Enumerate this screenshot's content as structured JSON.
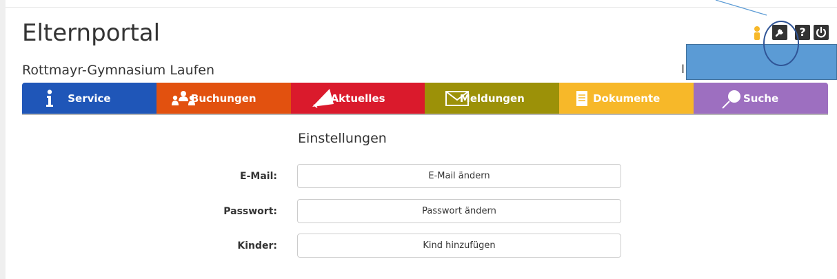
{
  "header": {
    "app_title": "Elternportal",
    "school_name": "Rottmayr-Gymnasium Laufen",
    "truncated_text": "I"
  },
  "toolbar": {
    "icons": [
      "user-icon",
      "wrench-icon",
      "help-icon",
      "power-icon"
    ],
    "help_glyph": "?"
  },
  "nav": {
    "items": [
      {
        "label": "Service",
        "icon": "info-icon",
        "color": "#1f56b8"
      },
      {
        "label": "Buchungen",
        "icon": "people-icon",
        "color": "#e2510f"
      },
      {
        "label": "Aktuelles",
        "icon": "megaphone-icon",
        "color": "#da1a2c"
      },
      {
        "label": "Meldungen",
        "icon": "envelope-icon",
        "color": "#9c9108"
      },
      {
        "label": "Dokumente",
        "icon": "document-icon",
        "color": "#f7b829"
      },
      {
        "label": "Suche",
        "icon": "search-icon",
        "color": "#9d6fc0"
      }
    ]
  },
  "settings": {
    "heading": "Einstellungen",
    "rows": [
      {
        "label": "E-Mail:",
        "button": "E-Mail ändern"
      },
      {
        "label": "Passwort:",
        "button": "Passwort ändern"
      },
      {
        "label": "Kinder:",
        "button": "Kind hinzufügen"
      }
    ]
  },
  "colors": {
    "callout_fill": "#5b9bd5",
    "callout_stroke": "#41719c",
    "text": "#333333"
  }
}
